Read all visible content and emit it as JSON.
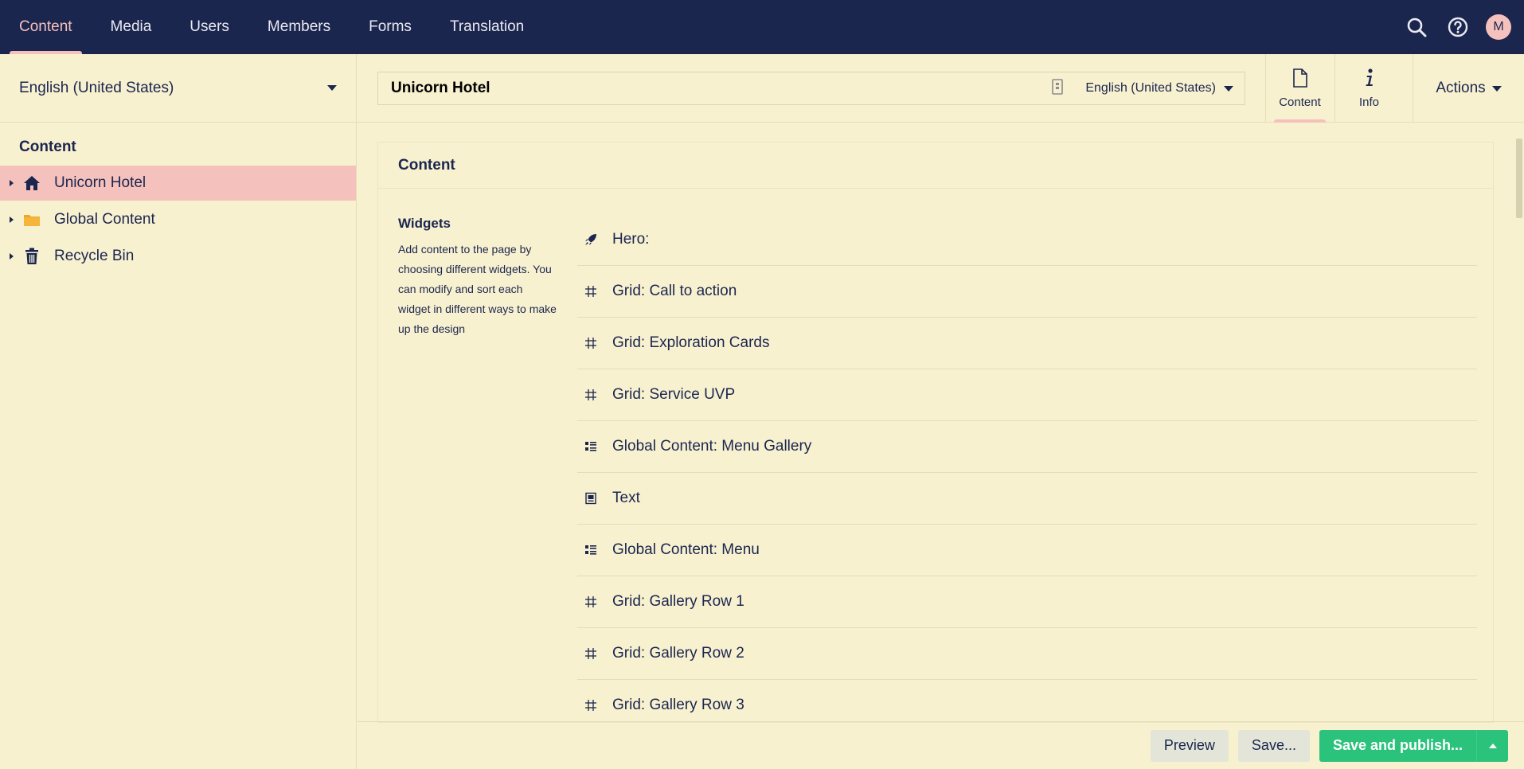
{
  "topnav": {
    "items": [
      {
        "label": "Content",
        "active": true
      },
      {
        "label": "Media",
        "active": false
      },
      {
        "label": "Users",
        "active": false
      },
      {
        "label": "Members",
        "active": false
      },
      {
        "label": "Forms",
        "active": false
      },
      {
        "label": "Translation",
        "active": false
      }
    ],
    "avatar_initial": "M"
  },
  "sidebar": {
    "language": "English (United States)",
    "tree_title": "Content",
    "tree": [
      {
        "label": "Unicorn Hotel",
        "icon": "home-icon",
        "selected": true
      },
      {
        "label": "Global Content",
        "icon": "folder-icon",
        "selected": false
      },
      {
        "label": "Recycle Bin",
        "icon": "trash-icon",
        "selected": false
      }
    ]
  },
  "editor": {
    "name_value": "Unicorn Hotel",
    "language": "English (United States)",
    "tabs": [
      {
        "label": "Content",
        "icon": "document-icon",
        "active": true
      },
      {
        "label": "Info",
        "icon": "info-icon",
        "active": false
      }
    ],
    "actions_label": "Actions"
  },
  "panel": {
    "title": "Content",
    "property_label": "Widgets",
    "property_description": "Add content to the page by choosing different widgets. You can modify and sort each widget in different ways to make up the design",
    "widgets": [
      {
        "label": "Hero:",
        "icon": "rocket-icon"
      },
      {
        "label": "Grid: Call to action",
        "icon": "grid-icon"
      },
      {
        "label": "Grid: Exploration Cards",
        "icon": "grid-icon"
      },
      {
        "label": "Grid: Service UVP",
        "icon": "grid-icon"
      },
      {
        "label": "Global Content: Menu Gallery",
        "icon": "list-icon"
      },
      {
        "label": "Text",
        "icon": "text-block-icon"
      },
      {
        "label": "Global Content: Menu",
        "icon": "list-icon"
      },
      {
        "label": "Grid: Gallery Row 1",
        "icon": "grid-icon"
      },
      {
        "label": "Grid: Gallery Row 2",
        "icon": "grid-icon"
      },
      {
        "label": "Grid: Gallery Row 3",
        "icon": "grid-icon"
      }
    ]
  },
  "footer": {
    "preview_label": "Preview",
    "save_label": "Save...",
    "publish_label": "Save and publish..."
  },
  "colors": {
    "topbar": "#1b264f",
    "background": "#f8f1d0",
    "accent_pink": "#f5c1bc",
    "publish_green": "#2bc37c"
  }
}
